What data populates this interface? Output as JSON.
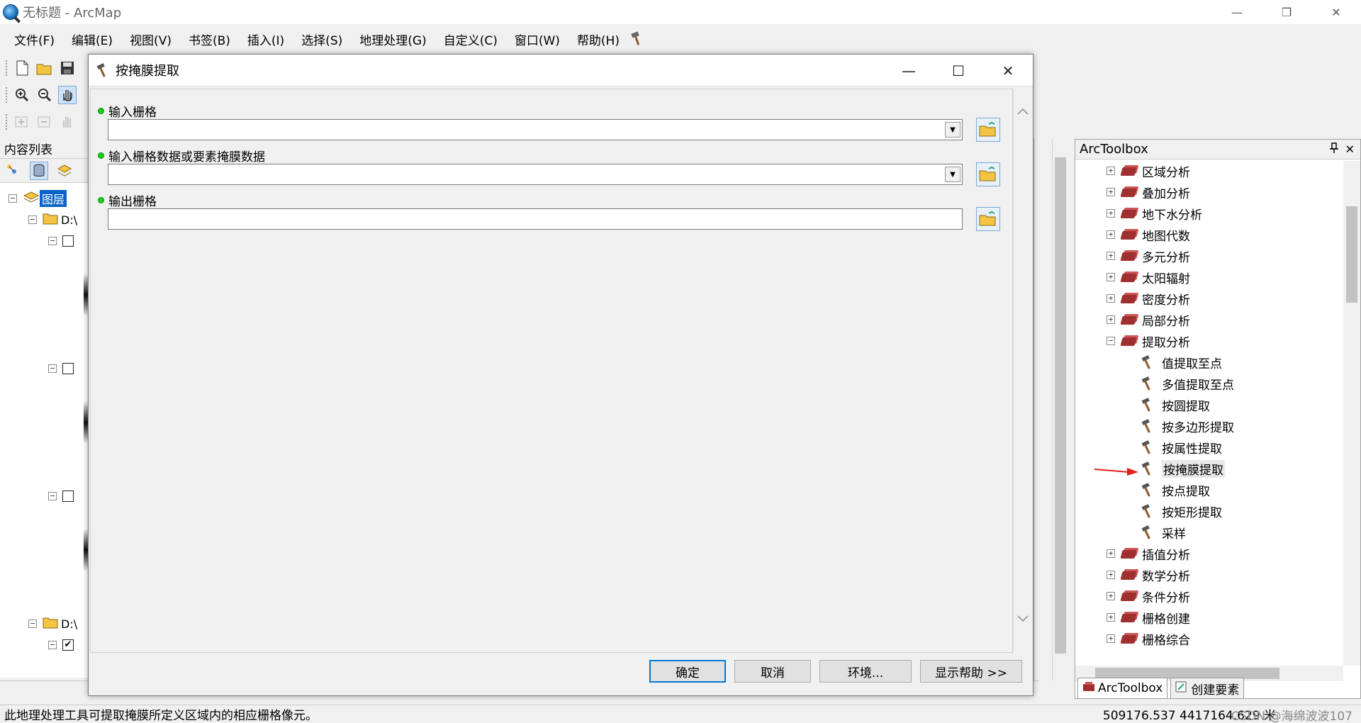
{
  "window": {
    "title": "无标题 - ArcMap",
    "controls": {
      "minimize": "—",
      "restore": "❐",
      "close": "✕"
    }
  },
  "menu": [
    "文件(F)",
    "编辑(E)",
    "视图(V)",
    "书签(B)",
    "插入(I)",
    "选择(S)",
    "地理处理(G)",
    "自定义(C)",
    "窗口(W)",
    "帮助(H)"
  ],
  "toc": {
    "title": "内容列表",
    "root_layer": "图层",
    "folder_1": "D:\\",
    "folder_2": "D:\\",
    "check_mark": "✔"
  },
  "dialog": {
    "title": "按掩膜提取",
    "controls": {
      "minimize": "—",
      "maximize": "☐",
      "close": "✕"
    },
    "params": [
      {
        "label": "输入栅格",
        "value": ""
      },
      {
        "label": "输入栅格数据或要素掩膜数据",
        "value": ""
      },
      {
        "label": "输出栅格",
        "value": ""
      }
    ],
    "buttons": {
      "ok": "确定",
      "cancel": "取消",
      "env": "环境...",
      "help": "显示帮助 >>"
    }
  },
  "arctoolbox": {
    "title": "ArcToolbox",
    "pin": "𝟜",
    "close": "✕",
    "toolsets_before": [
      "区域分析",
      "叠加分析",
      "地下水分析",
      "地图代数",
      "多元分析",
      "太阳辐射",
      "密度分析",
      "局部分析"
    ],
    "expanded_toolset": "提取分析",
    "tools": [
      "值提取至点",
      "多值提取至点",
      "按圆提取",
      "按多边形提取",
      "按属性提取",
      "按掩膜提取",
      "按点提取",
      "按矩形提取",
      "采样"
    ],
    "toolsets_after": [
      "插值分析",
      "数学分析",
      "条件分析",
      "栅格创建",
      "栅格综合"
    ],
    "tabs": {
      "toolbox": "ArcToolbox",
      "create_features": "创建要素"
    }
  },
  "status": {
    "message": "此地理处理工具可提取掩膜所定义区域内的相应栅格像元。",
    "coordinates": "509176.537  4417164.629 米",
    "watermark": "CSDN @海绵波波107"
  },
  "colors": {
    "selection": "#0a64c8",
    "arrow": "#e02020",
    "required_dot": "#12d412"
  }
}
